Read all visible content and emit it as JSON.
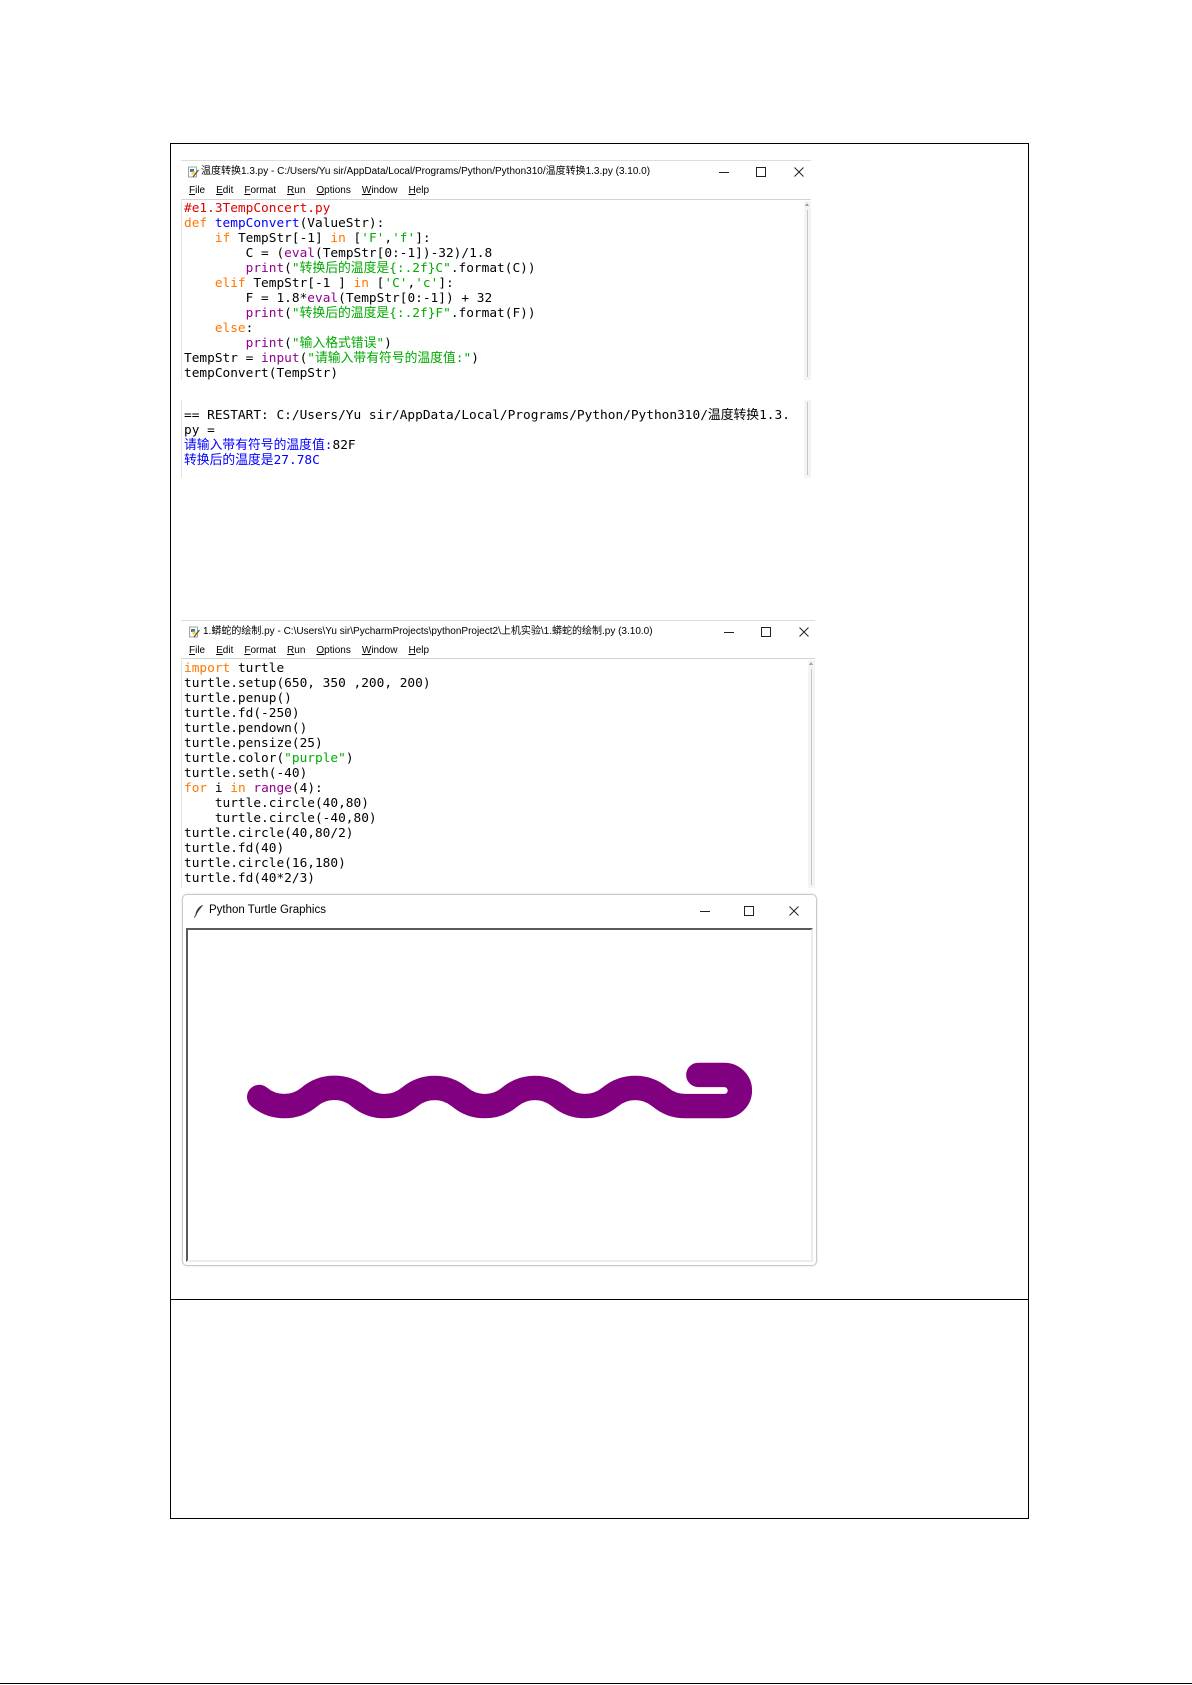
{
  "icons": {
    "idle_icon": "idle-file-icon",
    "turtle_icon": "feather-icon",
    "minimize": "minimize-icon",
    "maximize": "maximize-icon",
    "close": "close-icon"
  },
  "colors": {
    "rule": "#000000",
    "keyword": "#ff7700",
    "definition": "#0000ff",
    "builtin": "#900090",
    "string": "#00aa00",
    "comment": "#dd0000",
    "shell_output": "#0000ff"
  },
  "editor1": {
    "title": "温度转换1.3.py - C:/Users/Yu sir/AppData/Local/Programs/Python/Python310/温度转换1.3.py (3.10.0)",
    "menu": [
      "File",
      "Edit",
      "Format",
      "Run",
      "Options",
      "Window",
      "Help"
    ],
    "lines": [
      [
        [
          "#e1.3TempConcert.py",
          "#dd0000"
        ]
      ],
      [
        [
          "def",
          "#ff7700"
        ],
        [
          " tempConvert",
          "#0000ff"
        ],
        [
          "(ValueStr):",
          "#000000"
        ]
      ],
      [
        [
          "    if",
          "#ff7700"
        ],
        [
          " TempStr[-1] ",
          "#000000"
        ],
        [
          "in",
          "#ff7700"
        ],
        [
          " [",
          "#000000"
        ],
        [
          "'F'",
          "#00aa00"
        ],
        [
          ",",
          "#000000"
        ],
        [
          "'f'",
          "#00aa00"
        ],
        [
          "]:",
          "#000000"
        ]
      ],
      [
        [
          "        C = (",
          "#000000"
        ],
        [
          "eval",
          "#900090"
        ],
        [
          "(TempStr[0:-1])-32)/1.8",
          "#000000"
        ]
      ],
      [
        [
          "        print",
          "#900090"
        ],
        [
          "(",
          "#000000"
        ],
        [
          "\"转换后的温度是{:.2f}C\"",
          "#00aa00"
        ],
        [
          ".format(C))",
          "#000000"
        ]
      ],
      [
        [
          "    elif",
          "#ff7700"
        ],
        [
          " TempStr[-1 ] ",
          "#000000"
        ],
        [
          "in",
          "#ff7700"
        ],
        [
          " [",
          "#000000"
        ],
        [
          "'C'",
          "#00aa00"
        ],
        [
          ",",
          "#000000"
        ],
        [
          "'c'",
          "#00aa00"
        ],
        [
          "]:",
          "#000000"
        ]
      ],
      [
        [
          "        F = 1.8*",
          "#000000"
        ],
        [
          "eval",
          "#900090"
        ],
        [
          "(TempStr[0:-1]) + 32",
          "#000000"
        ]
      ],
      [
        [
          "        print",
          "#900090"
        ],
        [
          "(",
          "#000000"
        ],
        [
          "\"转换后的温度是{:.2f}F\"",
          "#00aa00"
        ],
        [
          ".format(F))",
          "#000000"
        ]
      ],
      [
        [
          "    else",
          "#ff7700"
        ],
        [
          ":",
          "#000000"
        ]
      ],
      [
        [
          "        print",
          "#900090"
        ],
        [
          "(",
          "#000000"
        ],
        [
          "\"输入格式错误\"",
          "#00aa00"
        ],
        [
          ")",
          "#000000"
        ]
      ],
      [
        [
          "TempStr = ",
          "#000000"
        ],
        [
          "input",
          "#900090"
        ],
        [
          "(",
          "#000000"
        ],
        [
          "\"请输入带有符号的温度值:\"",
          "#00aa00"
        ],
        [
          ")",
          "#000000"
        ]
      ],
      [
        [
          "tempConvert(TempStr)",
          "#000000"
        ]
      ]
    ]
  },
  "shell": {
    "lines": [
      [
        [
          "== RESTART: C:/Users/Yu sir/AppData/Local/Programs/Python/Python310/温度转换1.3.",
          "#000000"
        ]
      ],
      [
        [
          "py =",
          "#000000"
        ]
      ],
      [
        [
          "请输入带有符号的温度值:",
          "#0000ff"
        ],
        [
          "82F",
          "#000000"
        ]
      ],
      [
        [
          "转换后的温度是27.78C",
          "#0000ff"
        ]
      ]
    ]
  },
  "editor2": {
    "title": "1.蟒蛇的绘制.py - C:\\Users\\Yu sir\\PycharmProjects\\pythonProject2\\上机实验\\1.蟒蛇的绘制.py (3.10.0)",
    "menu": [
      "File",
      "Edit",
      "Format",
      "Run",
      "Options",
      "Window",
      "Help"
    ],
    "lines": [
      [
        [
          "import",
          "#ff7700"
        ],
        [
          " turtle",
          "#000000"
        ]
      ],
      [
        [
          "turtle.setup(650, 350 ,200, 200)",
          "#000000"
        ]
      ],
      [
        [
          "turtle.penup()",
          "#000000"
        ]
      ],
      [
        [
          "turtle.fd(-250)",
          "#000000"
        ]
      ],
      [
        [
          "turtle.pendown()",
          "#000000"
        ]
      ],
      [
        [
          "turtle.pensize(25)",
          "#000000"
        ]
      ],
      [
        [
          "turtle.color(",
          "#000000"
        ],
        [
          "\"purple\"",
          "#00aa00"
        ],
        [
          ")",
          "#000000"
        ]
      ],
      [
        [
          "turtle.seth(-40)",
          "#000000"
        ]
      ],
      [
        [
          "for",
          "#ff7700"
        ],
        [
          " i ",
          "#000000"
        ],
        [
          "in",
          "#ff7700"
        ],
        [
          " range",
          "#900090"
        ],
        [
          "(4):",
          "#000000"
        ]
      ],
      [
        [
          "    turtle.circle(40,80)",
          "#000000"
        ]
      ],
      [
        [
          "    turtle.circle(-40,80)",
          "#000000"
        ]
      ],
      [
        [
          "turtle.circle(40,80/2)",
          "#000000"
        ]
      ],
      [
        [
          "turtle.fd(40)",
          "#000000"
        ]
      ],
      [
        [
          "turtle.circle(16,180)",
          "#000000"
        ]
      ],
      [
        [
          "turtle.fd(40*2/3)",
          "#000000"
        ]
      ]
    ]
  },
  "turtle_window": {
    "title": "Python Turtle Graphics",
    "pen_color": "#800080"
  }
}
